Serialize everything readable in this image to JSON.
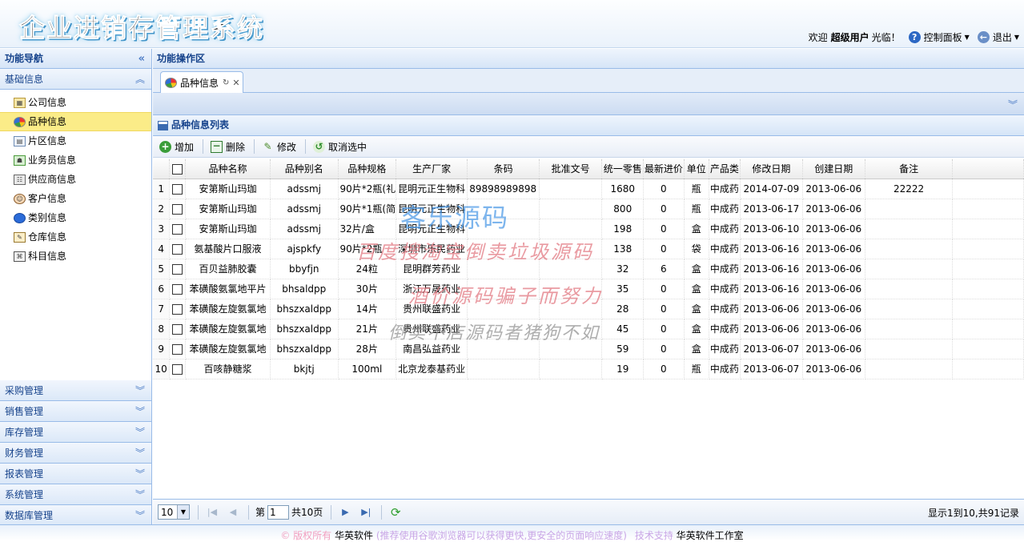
{
  "header": {
    "logo_text": "企业进销存管理系统",
    "welcome_prefix": "欢迎",
    "user_name": "超级用户",
    "welcome_suffix": "光临！",
    "control_panel_label": "控制面板",
    "logout_label": "退出"
  },
  "sidebar": {
    "title": "功能导航",
    "active_group": "基础信息",
    "items": [
      {
        "label": "公司信息",
        "icon": "company-icon"
      },
      {
        "label": "品种信息",
        "icon": "pie-chart-icon",
        "selected": true
      },
      {
        "label": "片区信息",
        "icon": "region-icon"
      },
      {
        "label": "业务员信息",
        "icon": "salesman-icon"
      },
      {
        "label": "供应商信息",
        "icon": "supplier-icon"
      },
      {
        "label": "客户信息",
        "icon": "customer-icon"
      },
      {
        "label": "类别信息",
        "icon": "category-icon"
      },
      {
        "label": "仓库信息",
        "icon": "warehouse-icon"
      },
      {
        "label": "科目信息",
        "icon": "subject-icon"
      }
    ],
    "groups": [
      "采购管理",
      "销售管理",
      "库存管理",
      "财务管理",
      "报表管理",
      "系统管理",
      "数据库管理"
    ]
  },
  "main": {
    "title": "功能操作区",
    "tab_label": "品种信息",
    "grid_title": "品种信息列表",
    "toolbar": {
      "add": "增加",
      "delete": "删除",
      "edit": "修改",
      "deselect": "取消选中"
    },
    "columns": [
      "品种名称",
      "品种别名",
      "品种规格",
      "生产厂家",
      "条码",
      "批准文号",
      "统一零售",
      "最新进价",
      "单位",
      "产品类",
      "修改日期",
      "创建日期",
      "备注"
    ],
    "rows": [
      [
        "1",
        "安第斯山玛珈",
        "adssmj",
        "90片*2瓶(礼",
        "昆明元正生物科",
        "89898989898",
        "",
        "1680",
        "0",
        "瓶",
        "中成药",
        "2014-07-09",
        "2013-06-06",
        "22222"
      ],
      [
        "2",
        "安第斯山玛珈",
        "adssmj",
        "90片*1瓶(简",
        "昆明元正生物科",
        "",
        "",
        "800",
        "0",
        "瓶",
        "中成药",
        "2013-06-17",
        "2013-06-06",
        ""
      ],
      [
        "3",
        "安第斯山玛珈",
        "adssmj",
        "32片/盒",
        "昆明元正生物科",
        "",
        "",
        "198",
        "0",
        "盒",
        "中成药",
        "2013-06-10",
        "2013-06-06",
        ""
      ],
      [
        "4",
        "氨基酸片口服液",
        "ajspkfy",
        "90片*2瓶",
        "深圳市乐民药业",
        "",
        "",
        "138",
        "0",
        "袋",
        "中成药",
        "2013-06-16",
        "2013-06-06",
        ""
      ],
      [
        "5",
        "百贝益肺胶囊",
        "bbyfjn",
        "24粒",
        "昆明群芳药业",
        "",
        "",
        "32",
        "6",
        "盒",
        "中成药",
        "2013-06-16",
        "2013-06-06",
        ""
      ],
      [
        "6",
        "苯磺酸氨氯地平片",
        "bhsaldpp",
        "30片",
        "浙江万晟药业",
        "",
        "",
        "35",
        "0",
        "盒",
        "中成药",
        "2013-06-16",
        "2013-06-06",
        ""
      ],
      [
        "7",
        "苯磺酸左旋氨氯地",
        "bhszxaldpp",
        "14片",
        "贵州联盛药业",
        "",
        "",
        "28",
        "0",
        "盒",
        "中成药",
        "2013-06-06",
        "2013-06-06",
        ""
      ],
      [
        "8",
        "苯磺酸左旋氨氯地",
        "bhszxaldpp",
        "21片",
        "贵州联盛药业",
        "",
        "",
        "45",
        "0",
        "盒",
        "中成药",
        "2013-06-06",
        "2013-06-06",
        ""
      ],
      [
        "9",
        "苯磺酸左旋氨氯地",
        "bhszxaldpp",
        "28片",
        "南昌弘益药业",
        "",
        "",
        "59",
        "0",
        "盒",
        "中成药",
        "2013-06-07",
        "2013-06-06",
        ""
      ],
      [
        "10",
        "百咳静糖浆",
        "bkjtj",
        "100ml",
        "北京龙泰基药业",
        "",
        "",
        "19",
        "0",
        "瓶",
        "中成药",
        "2013-06-07",
        "2013-06-06",
        ""
      ]
    ],
    "pager": {
      "page_size": "10",
      "page_prefix": "第",
      "page_value": "1",
      "page_total": "共10页",
      "summary": "显示1到10,共91记录"
    }
  },
  "footer": {
    "copyright": "© 版权所有",
    "company": "华英软件",
    "tip": "(推荐使用谷歌浏览器可以获得更快,更安全的页面响应速度)",
    "support_label": "技术支持",
    "support_name": "华英软件工作室"
  },
  "watermark": {
    "line1": "客乐源码",
    "line2": "百度搜淘宝倒卖垃圾源码",
    "line3": "酒价源码骗子而努力",
    "line4": "倒卖不店源码者猪狗不如"
  },
  "colors": {
    "accent": "#15428b",
    "border": "#99bbe8",
    "selected_row": "#fbec88"
  }
}
